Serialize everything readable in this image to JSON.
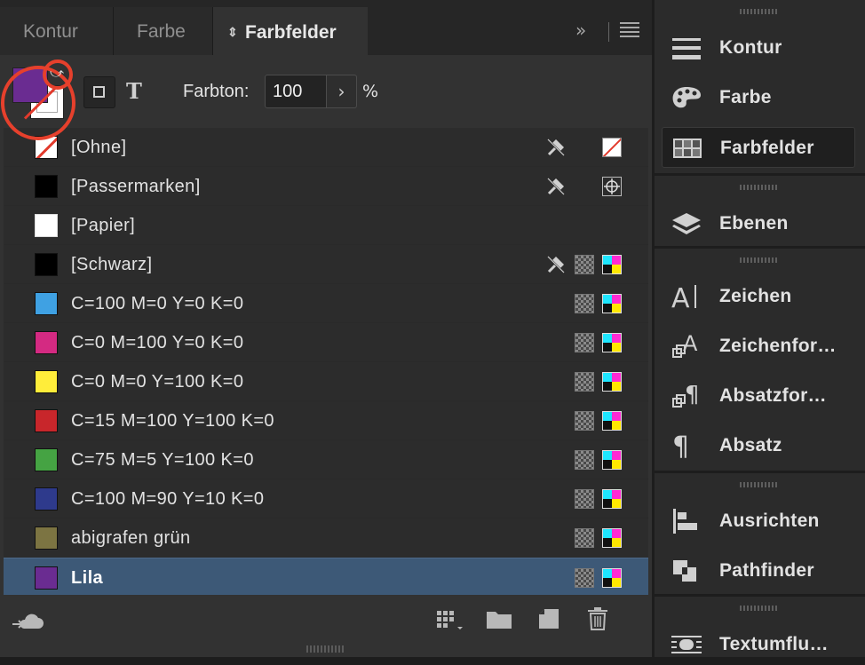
{
  "tabs": [
    {
      "label": "Kontur"
    },
    {
      "label": "Farbe"
    },
    {
      "label": "Farbfelder"
    }
  ],
  "tab_controls": {
    "more": "»",
    "menu": "≡"
  },
  "toolbar": {
    "fill_color": "#6a2c91",
    "text_button": "T",
    "tint_label": "Farbton:",
    "tint_value": "100",
    "tint_arrow": "›",
    "tint_unit": "%"
  },
  "swatches": [
    {
      "name": "[Ohne]",
      "color": "none",
      "lock": true,
      "type": "",
      "mode": "none"
    },
    {
      "name": "[Passermarken]",
      "color": "#000000",
      "lock": true,
      "type": "",
      "mode": "registration"
    },
    {
      "name": "[Papier]",
      "color": "#ffffff",
      "lock": false,
      "type": "",
      "mode": ""
    },
    {
      "name": "[Schwarz]",
      "color": "#000000",
      "lock": true,
      "type": "process",
      "mode": "cmyk"
    },
    {
      "name": "C=100 M=0 Y=0 K=0",
      "color": "#3fa1e3",
      "lock": false,
      "type": "process",
      "mode": "cmyk"
    },
    {
      "name": "C=0 M=100 Y=0 K=0",
      "color": "#d42a82",
      "lock": false,
      "type": "process",
      "mode": "cmyk"
    },
    {
      "name": "C=0 M=0 Y=100 K=0",
      "color": "#ffed3a",
      "lock": false,
      "type": "process",
      "mode": "cmyk"
    },
    {
      "name": "C=15 M=100 Y=100 K=0",
      "color": "#c8262b",
      "lock": false,
      "type": "process",
      "mode": "cmyk"
    },
    {
      "name": "C=75 M=5 Y=100 K=0",
      "color": "#45a343",
      "lock": false,
      "type": "process",
      "mode": "cmyk"
    },
    {
      "name": "C=100 M=90 Y=10 K=0",
      "color": "#2e3a8c",
      "lock": false,
      "type": "process",
      "mode": "cmyk"
    },
    {
      "name": "abigrafen grün",
      "color": "#7c7442",
      "lock": false,
      "type": "process",
      "mode": "cmyk"
    },
    {
      "name": "Lila",
      "color": "#6a2c91",
      "lock": false,
      "type": "process",
      "mode": "cmyk",
      "selected": true
    }
  ],
  "right_panel": {
    "groups": [
      {
        "items": [
          {
            "label": "Kontur",
            "icon": "stroke-lines-icon"
          },
          {
            "label": "Farbe",
            "icon": "palette-icon"
          },
          {
            "label": "Farbfelder",
            "icon": "swatches-grid-icon",
            "active": true
          }
        ]
      },
      {
        "items": [
          {
            "label": "Ebenen",
            "icon": "layers-icon"
          }
        ]
      },
      {
        "items": [
          {
            "label": "Zeichen",
            "icon": "character-icon"
          },
          {
            "label": "Zeichenfor…",
            "icon": "character-style-icon"
          },
          {
            "label": "Absatzfor…",
            "icon": "paragraph-style-icon"
          },
          {
            "label": "Absatz",
            "icon": "pilcrow-icon"
          }
        ]
      },
      {
        "items": [
          {
            "label": "Ausrichten",
            "icon": "align-icon"
          },
          {
            "label": "Pathfinder",
            "icon": "pathfinder-icon"
          }
        ]
      },
      {
        "items": [
          {
            "label": "Textumflu…",
            "icon": "text-wrap-icon"
          }
        ]
      }
    ]
  }
}
